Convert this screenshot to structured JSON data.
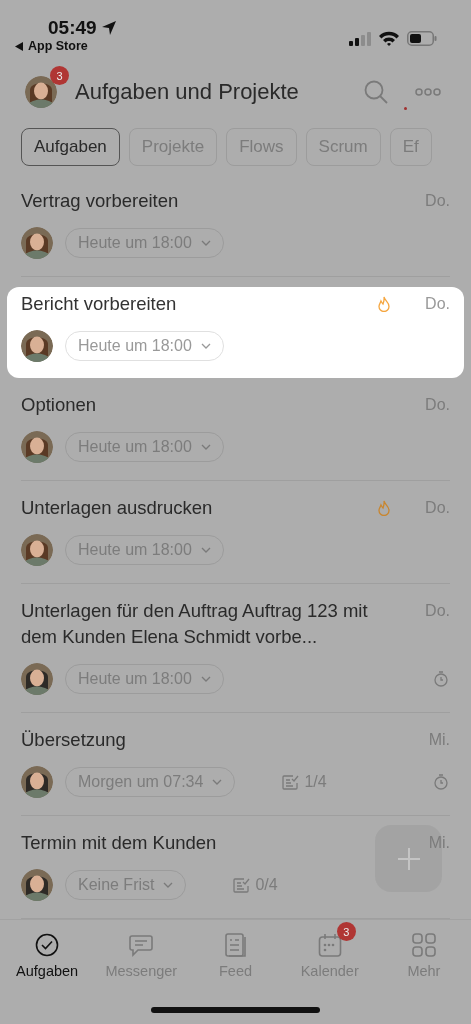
{
  "status_bar": {
    "time": "05:49",
    "back_link": "App Store"
  },
  "header": {
    "title": "Aufgaben und Projekte",
    "badge": "3"
  },
  "filters": [
    {
      "label": "Aufgaben",
      "selected": true
    },
    {
      "label": "Projekte",
      "selected": false
    },
    {
      "label": "Flows",
      "selected": false
    },
    {
      "label": "Scrum",
      "selected": false
    },
    {
      "label": "Ef",
      "selected": false
    }
  ],
  "tasks": [
    {
      "title": "Vertrag vorbereiten",
      "day": "Do.",
      "deadline": "Heute um 18:00",
      "hot": false,
      "timer": false,
      "selected": false
    },
    {
      "title": "Bericht vorbereiten",
      "day": "Do.",
      "deadline": "Heute um 18:00",
      "hot": true,
      "timer": false,
      "selected": true
    },
    {
      "title": "Optionen",
      "day": "Do.",
      "deadline": "Heute um 18:00",
      "hot": false,
      "timer": false,
      "selected": false
    },
    {
      "title": "Unterlagen ausdrucken",
      "day": "Do.",
      "deadline": "Heute um 18:00",
      "hot": true,
      "timer": false,
      "selected": false
    },
    {
      "title": "Unterlagen für den Auftrag Auftrag 123 mit dem Kunden Elena  Schmidt vorbe...",
      "day": "Do.",
      "deadline": "Heute um 18:00",
      "hot": false,
      "timer": true,
      "selected": false
    },
    {
      "title": "Übersetzung",
      "day": "Mi.",
      "deadline": "Morgen um 07:34",
      "checklist": "1/4",
      "hot": false,
      "timer": true,
      "selected": false
    },
    {
      "title": "Termin mit dem Kunden",
      "day": "Mi.",
      "deadline": "Keine Frist",
      "checklist": "0/4",
      "hot": false,
      "timer": false,
      "selected": false
    }
  ],
  "tab_bar": [
    {
      "label": "Aufgaben",
      "selected": true
    },
    {
      "label": "Messenger",
      "selected": false
    },
    {
      "label": "Feed",
      "selected": false
    },
    {
      "label": "Kalender",
      "selected": false,
      "badge": "3"
    },
    {
      "label": "Mehr",
      "selected": false
    }
  ]
}
